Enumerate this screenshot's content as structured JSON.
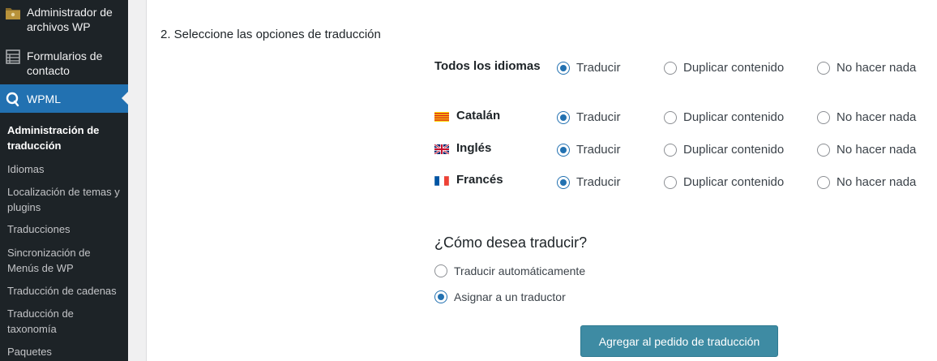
{
  "sidebar": {
    "menu": [
      {
        "label": "Administrador de archivos WP",
        "icon": "folder-icon"
      },
      {
        "label": "Formularios de contacto",
        "icon": "form-icon"
      },
      {
        "label": "WPML",
        "icon": "wpml-icon"
      }
    ],
    "submenu": [
      "Administración de traducción",
      "Idiomas",
      "Localización de temas y plugins",
      "Traducciones",
      "Sincronización de Menús de WP",
      "Traducción de cadenas",
      "Traducción de taxonomía",
      "Paquetes"
    ]
  },
  "main": {
    "section_title": "2. Seleccione las opciones de traducción",
    "options": {
      "translate": "Traducir",
      "duplicate": "Duplicar contenido",
      "nothing": "No hacer nada"
    },
    "languages": [
      {
        "label": "Todos los idiomas",
        "flag": null,
        "selected": "translate"
      },
      {
        "label": "Catalán",
        "flag": "catalan-flag-icon",
        "selected": "translate"
      },
      {
        "label": "Inglés",
        "flag": "uk-flag-icon",
        "selected": "translate"
      },
      {
        "label": "Francés",
        "flag": "france-flag-icon",
        "selected": "translate"
      }
    ],
    "how_title": "¿Cómo desea traducir?",
    "how_options": [
      {
        "label": "Traducir automáticamente",
        "checked": false
      },
      {
        "label": "Asignar a un traductor",
        "checked": true
      }
    ],
    "submit_label": "Agregar al pedido de traducción"
  },
  "colors": {
    "sidebar_bg": "#1d2327",
    "active_menu": "#2271b1",
    "radio_accent": "#2271b1",
    "button_bg": "#3e8ba3"
  }
}
